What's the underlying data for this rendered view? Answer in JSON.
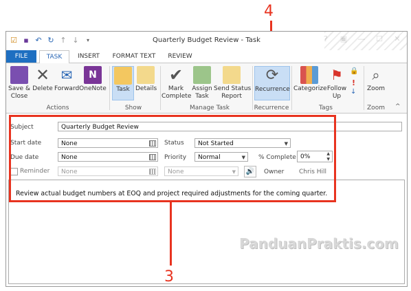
{
  "callouts": {
    "top": "4",
    "bottom": "3"
  },
  "window": {
    "title": "Quarterly Budget Review - Task"
  },
  "tabs": [
    "FILE",
    "TASK",
    "INSERT",
    "FORMAT TEXT",
    "REVIEW"
  ],
  "ribbon": {
    "buttons": {
      "save_close": "Save &\nClose",
      "delete": "Delete",
      "forward": "Forward",
      "onenote": "OneNote",
      "task": "Task",
      "details": "Details",
      "mark_complete": "Mark\nComplete",
      "assign_task": "Assign\nTask",
      "send_status": "Send Status\nReport",
      "recurrence": "Recurrence",
      "categorize": "Categorize",
      "follow_up": "Follow\nUp",
      "zoom": "Zoom"
    },
    "groups": {
      "actions": "Actions",
      "show": "Show",
      "manage_task": "Manage Task",
      "recurrence": "Recurrence",
      "tags": "Tags",
      "zoom": "Zoom"
    }
  },
  "form": {
    "subject_label": "Subject",
    "subject_value": "Quarterly Budget Review",
    "start_date_label": "Start date",
    "start_date_value": "None",
    "due_date_label": "Due date",
    "due_date_value": "None",
    "reminder_label": "Reminder",
    "reminder_date_value": "None",
    "reminder_time_value": "None",
    "status_label": "Status",
    "status_value": "Not Started",
    "priority_label": "Priority",
    "priority_value": "Normal",
    "percent_label": "% Complete",
    "percent_value": "0%",
    "owner_label": "Owner",
    "owner_value": "Chris Hill",
    "body_text": "Review actual budget numbers at EOQ and project required adjustments for the coming quarter."
  },
  "watermark": "PanduanPraktis.com"
}
